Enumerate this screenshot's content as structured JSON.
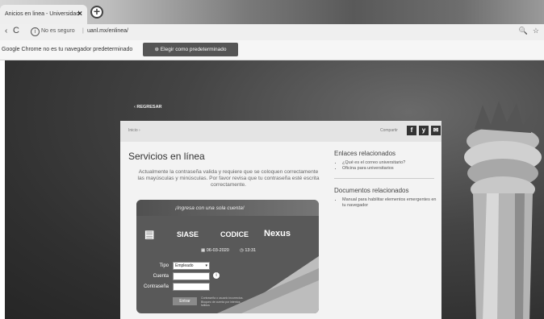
{
  "browser": {
    "tab_title": "Anicios en linea - Universidad",
    "tab_close": "×",
    "new_tab": "+",
    "back_icon": "‹",
    "reload_icon": "C",
    "info_icon": "i",
    "security_text": "No es seguro",
    "url": "uanl.mx/enlinea/",
    "zoom_icon": "🔍",
    "star_icon": "☆",
    "infobar_message": "Google Chrome no es tu navegador predeterminado",
    "infobar_button": "Elegir como predeterminado"
  },
  "page": {
    "back_link": "‹ REGRESAR",
    "breadcrumb": "Inicio ›",
    "share_label": "Compartir",
    "share_icons": [
      "f",
      "y",
      "✉"
    ],
    "title": "Servicios en línea",
    "note": "Actualmente la contraseña valida y requiere que se coloquen correctamente las mayúsculas y minúsculas. Por favor revisa que tu contraseña esté escrita correctamente.",
    "related_links_title": "Enlaces relacionados",
    "related_links": [
      "¿Qué es el correo universitario?",
      "Oficina para universitarios"
    ],
    "related_docs_title": "Documentos relacionados",
    "related_docs": [
      "Manual para habilitar elementos emergentes en tu navegador"
    ]
  },
  "login": {
    "tagline": "¡Ingresa con una sola cuenta!",
    "logos": [
      "SIASE",
      "CODICE",
      "Nexus"
    ],
    "date": "06-03-2020",
    "time": "13:31",
    "tipo_label": "Tipo",
    "tipo_value": "Empleado",
    "cuenta_label": "Cuenta",
    "password_label": "Contraseña",
    "enter_label": "Entrar",
    "hint": "Contraseña o usuario incorrectos. Bloqueo de cuenta por intentos fallidos"
  }
}
